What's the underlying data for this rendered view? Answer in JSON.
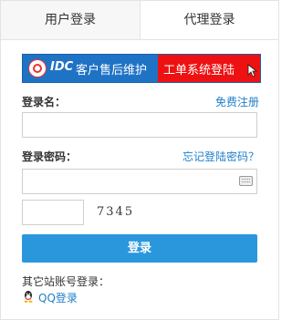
{
  "tabs": {
    "user_login": "用户登录",
    "agent_login": "代理登录"
  },
  "banner": {
    "brand": "IDC",
    "service_text": "客户售后维护",
    "ticket_text": "工单系统登陆"
  },
  "form": {
    "username_label": "登录名：",
    "register_link": "免费注册",
    "password_label": "登录密码：",
    "forgot_link": "忘记登陆密码？",
    "captcha_code": "7345",
    "submit_label": "登录"
  },
  "other": {
    "title": "其它站账号登录：",
    "qq_label": "QQ登录"
  },
  "colors": {
    "accent_blue": "#2a97dd",
    "banner_blue": "#1f73c5",
    "banner_red": "#e11111",
    "link": "#1f7ec9"
  },
  "icons": [
    "hl-logo-icon",
    "cursor-hand-icon",
    "keyboard-icon",
    "qq-penguin-icon"
  ]
}
